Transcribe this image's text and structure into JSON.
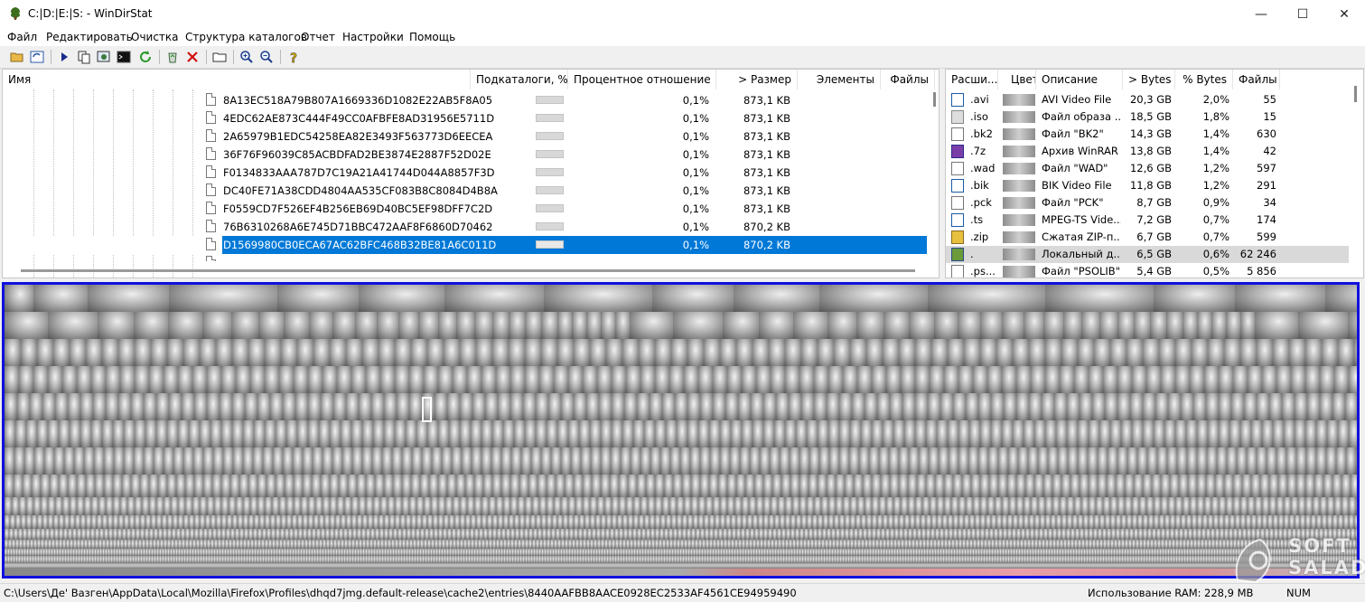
{
  "window": {
    "title": "C:|D:|E:|S: - WinDirStat",
    "minimize": "—",
    "maximize": "☐",
    "close": "✕"
  },
  "menu": [
    "Файл",
    "Редактировать",
    "Очистка",
    "Структура каталогов",
    "Отчет",
    "Настройки",
    "Помощь"
  ],
  "tree": {
    "columns": [
      "Имя",
      "Подкаталоги, %",
      "Процентное отношение",
      "> Размер",
      "Элементы",
      "Файлы"
    ],
    "rows": [
      {
        "name": "8A13EC518A79B807A1669336D1082E22AB5F8A05",
        "percent": "0,1%",
        "size": "873,1 KB"
      },
      {
        "name": "4EDC62AE873C444F49CC0AFBFE8AD31956E5711D",
        "percent": "0,1%",
        "size": "873,1 KB"
      },
      {
        "name": "2A65979B1EDC54258EA82E3493F563773D6EECEA",
        "percent": "0,1%",
        "size": "873,1 KB"
      },
      {
        "name": "36F76F96039C85ACBDFAD2BE3874E2887F52D02E",
        "percent": "0,1%",
        "size": "873,1 KB"
      },
      {
        "name": "F0134833AAA787D7C19A21A41744D044A8857F3D",
        "percent": "0,1%",
        "size": "873,1 KB"
      },
      {
        "name": "DC40FE71A38CDD4804AA535CF083B8C8084D4B8A",
        "percent": "0,1%",
        "size": "873,1 KB"
      },
      {
        "name": "F0559CD7F526EF4B256EB69D40BC5EF98DFF7C2D",
        "percent": "0,1%",
        "size": "873,1 KB"
      },
      {
        "name": "76B6310268A6E745D71BBC472AAF8F6860D70462",
        "percent": "0,1%",
        "size": "870,2 KB"
      },
      {
        "name": "D1569980CB0ECA67AC62BFC468B32BE81A6C011D",
        "percent": "0,1%",
        "size": "870,2 KB",
        "selected": true
      }
    ]
  },
  "extensions": {
    "columns": [
      "Расши...",
      "Цвет",
      "Описание",
      "> Bytes",
      "% Bytes",
      "Файлы"
    ],
    "rows": [
      {
        "ext": ".avi",
        "desc": "AVI Video File",
        "bytes": "20,3 GB",
        "pct": "2,0%",
        "files": "55",
        "icon": "video-file-icon"
      },
      {
        "ext": ".iso",
        "desc": "Файл образа ...",
        "bytes": "18,5 GB",
        "pct": "1,8%",
        "files": "15",
        "icon": "disc-image-icon"
      },
      {
        "ext": ".bk2",
        "desc": "Файл \"BK2\"",
        "bytes": "14,3 GB",
        "pct": "1,4%",
        "files": "630",
        "icon": "generic-file-icon"
      },
      {
        "ext": ".7z",
        "desc": "Архив WinRAR",
        "bytes": "13,8 GB",
        "pct": "1,4%",
        "files": "42",
        "icon": "winrar-archive-icon"
      },
      {
        "ext": ".wad",
        "desc": "Файл \"WAD\"",
        "bytes": "12,6 GB",
        "pct": "1,2%",
        "files": "597",
        "icon": "generic-file-icon"
      },
      {
        "ext": ".bik",
        "desc": "BIK Video File",
        "bytes": "11,8 GB",
        "pct": "1,2%",
        "files": "291",
        "icon": "video-file-icon"
      },
      {
        "ext": ".pck",
        "desc": "Файл \"PCK\"",
        "bytes": "8,7 GB",
        "pct": "0,9%",
        "files": "34",
        "icon": "generic-file-icon"
      },
      {
        "ext": ".ts",
        "desc": "MPEG-TS Vide...",
        "bytes": "7,2 GB",
        "pct": "0,7%",
        "files": "174",
        "icon": "video-file-icon"
      },
      {
        "ext": ".zip",
        "desc": "Сжатая ZIP-п...",
        "bytes": "6,7 GB",
        "pct": "0,7%",
        "files": "599",
        "icon": "zip-folder-icon"
      },
      {
        "ext": ".",
        "desc": "Локальный д...",
        "bytes": "6,5 GB",
        "pct": "0,6%",
        "files": "62 246",
        "icon": "local-disk-icon",
        "highlight": true
      },
      {
        "ext": ".ps...",
        "desc": "Файл \"PSOLIB\"",
        "bytes": "5,4 GB",
        "pct": "0,5%",
        "files": "5 856",
        "icon": "generic-file-icon"
      }
    ]
  },
  "status": {
    "path": "C:\\Users\\Де' Вазген\\AppData\\Local\\Mozilla\\Firefox\\Profiles\\dhqd7jmg.default-release\\cache2\\entries\\8440AAFBB8AACE0928EC2533AF4561CE94959490",
    "ram_label": "Использование RAM:",
    "ram_value": "228,9 MB",
    "num": "NUM"
  },
  "watermark": {
    "line1": "SOFT",
    "line2": "SALAD"
  },
  "colors": {
    "treemap_border": "#1010e0",
    "selection": "#0078d7"
  }
}
